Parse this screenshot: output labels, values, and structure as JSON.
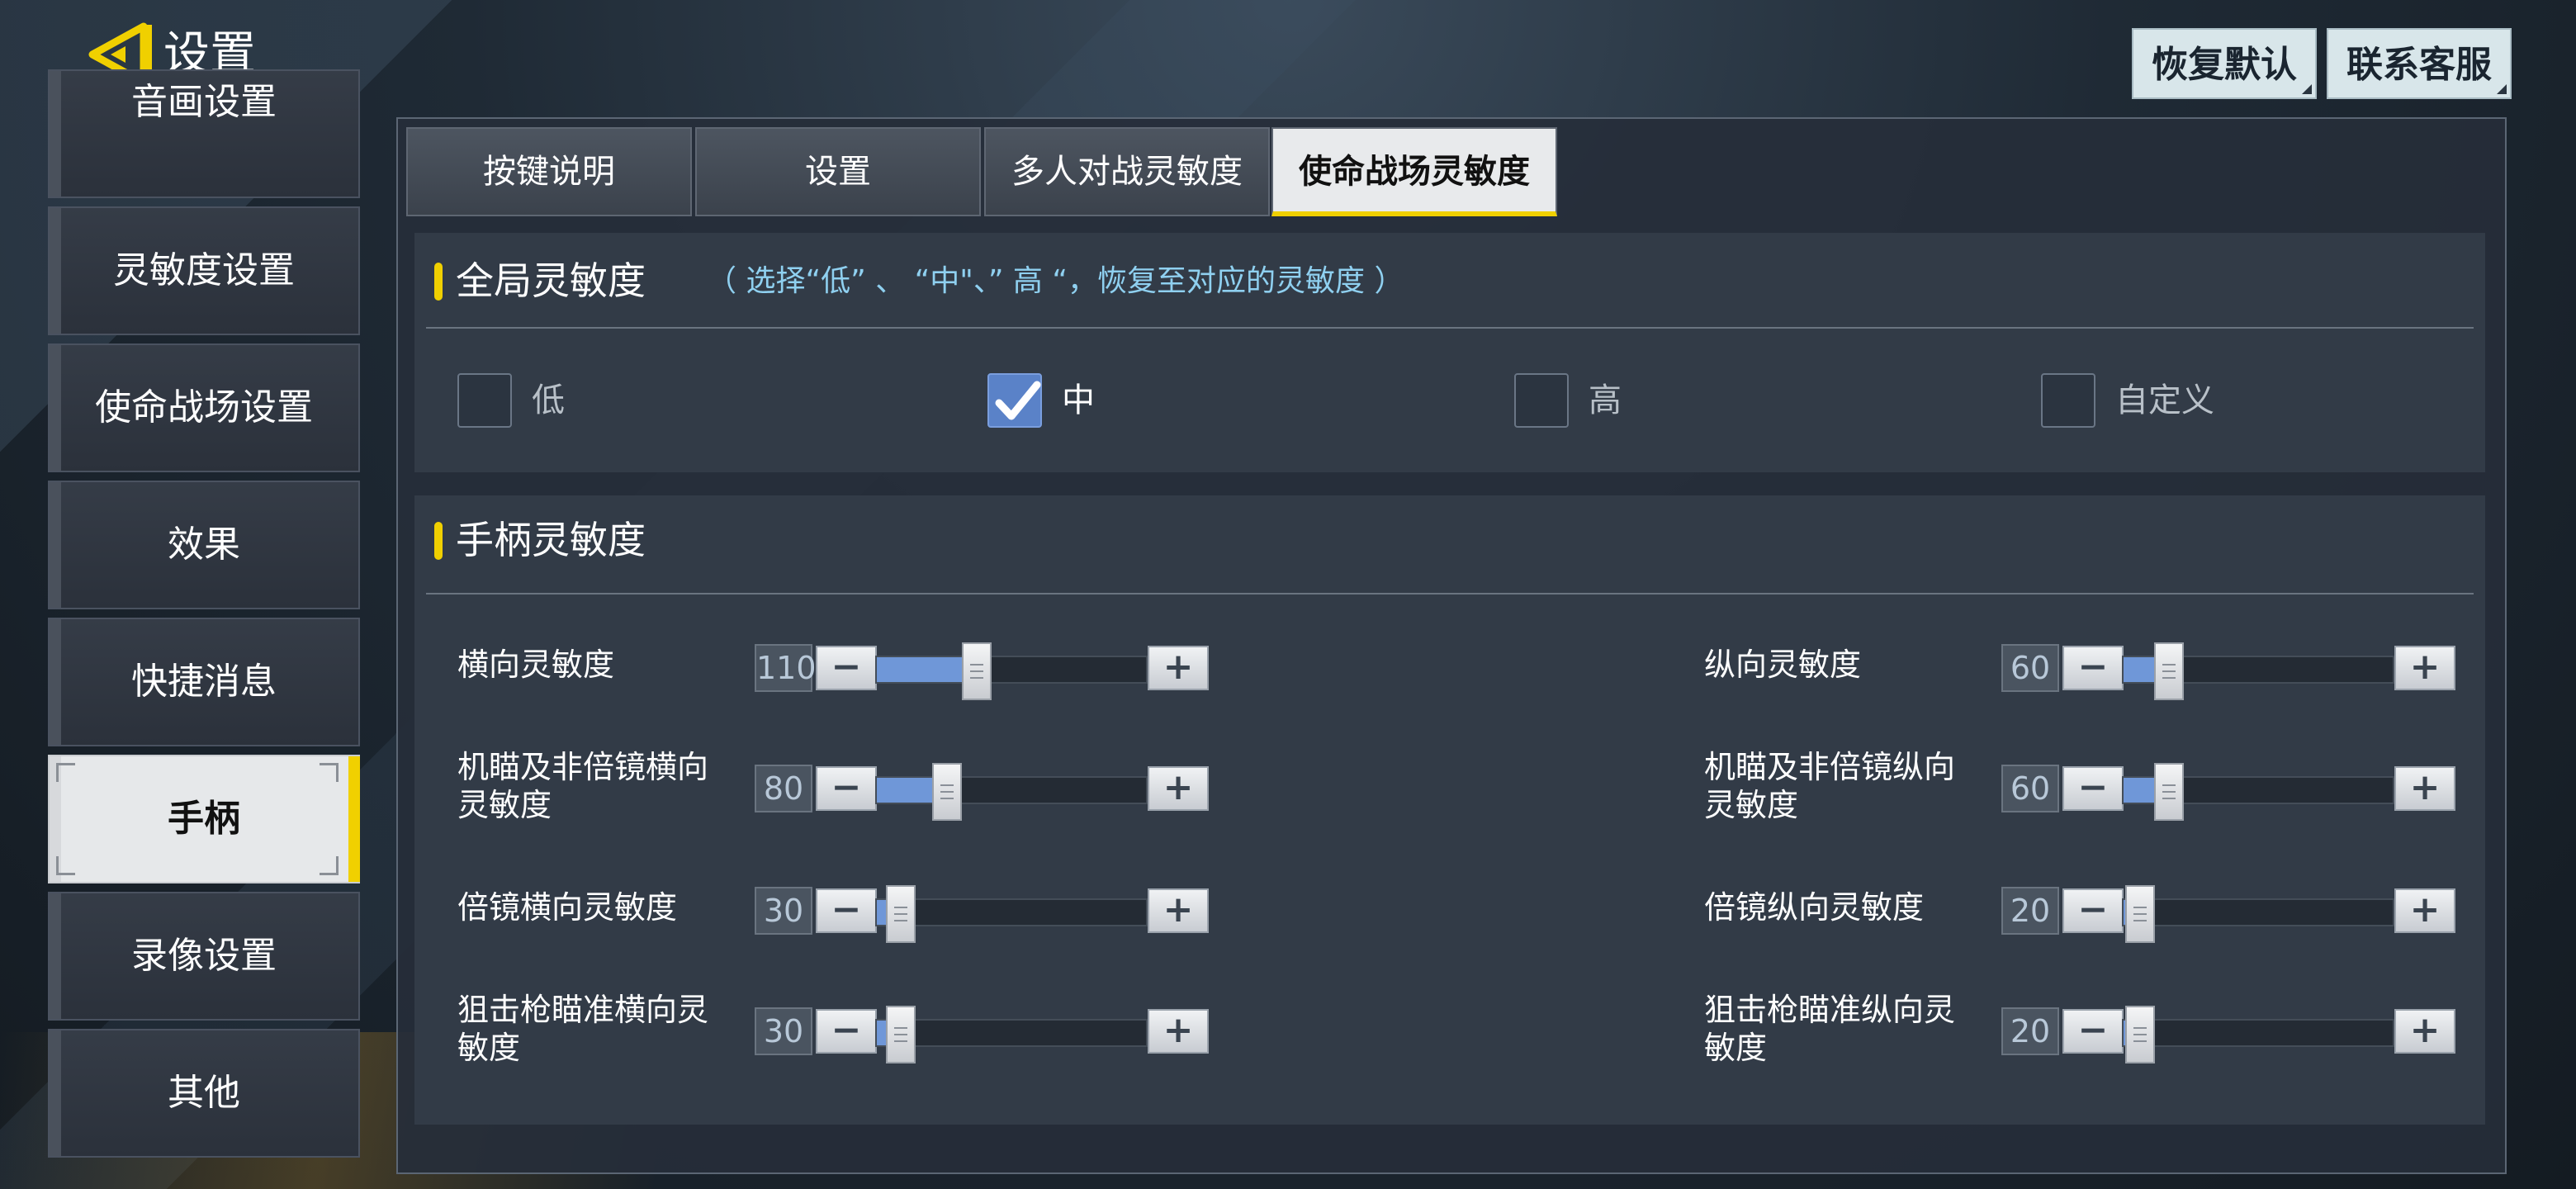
{
  "header": {
    "title": "设置",
    "restore_default": "恢复默认",
    "contact_support": "联系客服"
  },
  "sidebar": {
    "items": [
      {
        "label": "音画设置",
        "active": false
      },
      {
        "label": "灵敏度设置",
        "active": false
      },
      {
        "label": "使命战场设置",
        "active": false
      },
      {
        "label": "效果",
        "active": false
      },
      {
        "label": "快捷消息",
        "active": false
      },
      {
        "label": "手柄",
        "active": true
      },
      {
        "label": "录像设置",
        "active": false
      },
      {
        "label": "其他",
        "active": false
      }
    ]
  },
  "tabs": [
    {
      "label": "按键说明",
      "active": false
    },
    {
      "label": "设置",
      "active": false
    },
    {
      "label": "多人对战灵敏度",
      "active": false
    },
    {
      "label": "使命战场灵敏度",
      "active": true
    }
  ],
  "global": {
    "title": "全局灵敏度",
    "hint": "（ 选择“低” 、 “中\"、” 高 “，恢复至对应的灵敏度 ）",
    "options": [
      {
        "label": "低",
        "checked": false
      },
      {
        "label": "中",
        "checked": true
      },
      {
        "label": "高",
        "checked": false
      },
      {
        "label": "自定义",
        "checked": false
      }
    ]
  },
  "controller": {
    "title": "手柄灵敏度",
    "sliders": [
      {
        "label": "横向灵敏度",
        "value": "110",
        "fraction": 0.37
      },
      {
        "label": "纵向灵敏度",
        "value": "60",
        "fraction": 0.17
      },
      {
        "label": "机瞄及非倍镜横向灵敏度",
        "value": "80",
        "fraction": 0.26
      },
      {
        "label": "机瞄及非倍镜纵向灵敏度",
        "value": "60",
        "fraction": 0.17
      },
      {
        "label": "倍镜横向灵敏度",
        "value": "30",
        "fraction": 0.09
      },
      {
        "label": "倍镜纵向灵敏度",
        "value": "20",
        "fraction": 0.06
      },
      {
        "label": "狙击枪瞄准横向灵敏度",
        "value": "30",
        "fraction": 0.09
      },
      {
        "label": "狙击枪瞄准纵向灵敏度",
        "value": "20",
        "fraction": 0.06
      }
    ],
    "minus": "−",
    "plus": "+"
  },
  "colors": {
    "accent": "#f0d000",
    "slider_fill": "#6f97d8",
    "hint": "#8fd0f0"
  }
}
